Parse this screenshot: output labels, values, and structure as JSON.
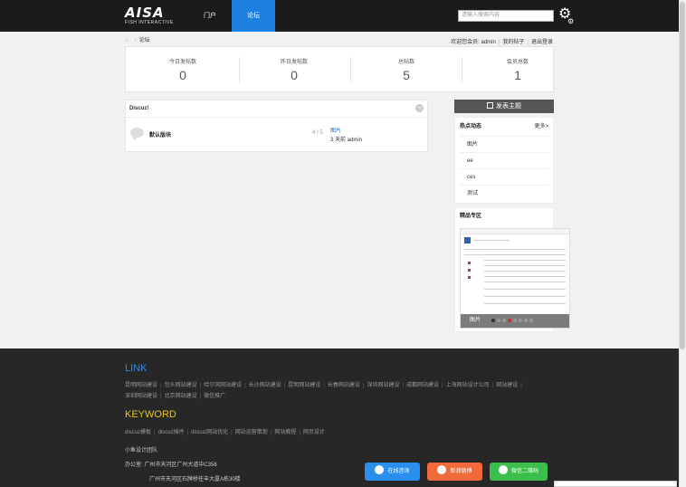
{
  "header": {
    "logo_text": "AISA",
    "logo_sub": "FISH INTERACTIVE",
    "nav": {
      "portal": "门户",
      "forum": "论坛"
    },
    "search_placeholder": "请输入搜索内容",
    "colors": {
      "bg": "#1b1b1b",
      "active": "#1e80df"
    }
  },
  "breadcrumb": {
    "home_icon": "home-icon",
    "sep": "›",
    "current": "论坛"
  },
  "userbar": {
    "welcome": "欢迎您会员: admin",
    "my_posts": "我的帖子",
    "logout": "退出登录"
  },
  "stats": [
    {
      "label": "今日发帖数",
      "value": "0"
    },
    {
      "label": "昨日发帖数",
      "value": "0"
    },
    {
      "label": "总帖数",
      "value": "5"
    },
    {
      "label": "会员总数",
      "value": "1"
    }
  ],
  "forum": {
    "title": "Discuz!",
    "collapse_icon": "−",
    "row": {
      "name": "默认版块",
      "count": "4 / 5",
      "last_title": "图片",
      "last_meta": "3 天前  admin"
    }
  },
  "sidebar": {
    "post_button": "发表主题",
    "hot": {
      "title": "热点动态",
      "more": "更多>",
      "items": [
        "图片",
        "ee",
        "ces",
        "测试"
      ]
    },
    "featured": {
      "title": "精品专区",
      "caption": "图片"
    }
  },
  "footer": {
    "link_heading": "LINK",
    "links_row1": [
      "昆明网站建设",
      "包头网站建设",
      "哈尔滨网站建设",
      "长沙网站建设",
      "昆明网站建设",
      "长春网站建设",
      "深圳网站建设",
      "成都网站建设",
      "上海网站设计公司",
      "网站建设"
    ],
    "links_row2": [
      "深圳网站建设",
      "北京网站建设",
      "微信推广"
    ],
    "keyword_heading": "KEYWORD",
    "keywords": [
      "discuz模板",
      "discuz插件",
      "discuz网站优化",
      "网站运营策划",
      "网站教程",
      "网页设计"
    ],
    "team": "小鱼设计团队",
    "office_label": "办公室:",
    "address1": "广州市天河区广州大道中C356",
    "address2": "广州市天河区石牌桥任丰大厦A栋30楼",
    "float": {
      "qq": "在线咨询",
      "weibo": "新浪微博",
      "wechat": "微信二维码"
    }
  }
}
